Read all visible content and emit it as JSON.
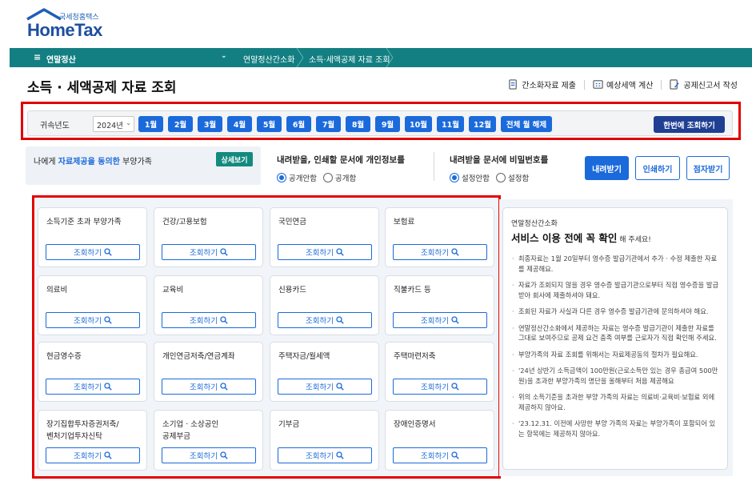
{
  "logo": {
    "subtitle": "국세청홈택스",
    "brand": "HomeTax"
  },
  "nav": {
    "menu_label": "연말정산",
    "crumb1": "연말정산간소화",
    "crumb2": "소득·세액공제 자료 조회"
  },
  "page_title": "소득 · 세액공제 자료 조회",
  "top_links": [
    {
      "label": "간소화자료 제출",
      "icon": "document-submit-icon"
    },
    {
      "label": "예상세액 계산",
      "icon": "calculator-icon"
    },
    {
      "label": "공제신고서 작성",
      "icon": "form-edit-icon"
    }
  ],
  "filter": {
    "year_label": "귀속년도",
    "year_value": "2024년",
    "months": [
      "1월",
      "2월",
      "3월",
      "4월",
      "5월",
      "6월",
      "7월",
      "8월",
      "9월",
      "10월",
      "11월",
      "12월"
    ],
    "all_clear": "전체 월 해제",
    "query_all": "한번에 조회하기"
  },
  "consent": {
    "prefix": "나에게 ",
    "highlight": "자료제공을 동의한",
    "suffix": " 부양가족",
    "detail_button": "상세보기"
  },
  "print_privacy": {
    "title": "내려받을, 인쇄할 문서에 개인정보를",
    "options": [
      "공개안함",
      "공개함"
    ],
    "selected": 0
  },
  "doc_password": {
    "title": "내려받을 문서에 비밀번호를",
    "options": [
      "설정안함",
      "설정함"
    ],
    "selected": 0
  },
  "actions": {
    "download": "내려받기",
    "print": "인쇄하기",
    "braille": "점자받기"
  },
  "cards": [
    {
      "title": "소득기준 초과 부양가족",
      "button": "조회하기"
    },
    {
      "title": "건강/고용보험",
      "button": "조회하기"
    },
    {
      "title": "국민연금",
      "button": "조회하기"
    },
    {
      "title": "보험료",
      "button": "조회하기"
    },
    {
      "title": "의료비",
      "button": "조회하기"
    },
    {
      "title": "교육비",
      "button": "조회하기"
    },
    {
      "title": "신용카드",
      "button": "조회하기"
    },
    {
      "title": "직불카드 등",
      "button": "조회하기"
    },
    {
      "title": "현금영수증",
      "button": "조회하기"
    },
    {
      "title": "개인연금저축/연금계좌",
      "button": "조회하기"
    },
    {
      "title": "주택자금/월세액",
      "button": "조회하기"
    },
    {
      "title": "주택마련저축",
      "button": "조회하기"
    },
    {
      "title": "장기집합투자증권저축/\n벤처기업투자신탁",
      "button": "조회하기"
    },
    {
      "title": "소기업 · 소상공인\n공제부금",
      "button": "조회하기"
    },
    {
      "title": "기부금",
      "button": "조회하기"
    },
    {
      "title": "장애인증명서",
      "button": "조회하기"
    }
  ],
  "notice": {
    "tag": "연말정산간소화",
    "headline": "서비스 이용 전에 꼭 확인",
    "headline_suffix": " 해 주세요!",
    "items": [
      "최종자료는 1월 20일부터 영수증 발급기관에서 추가 · 수정 제출한 자료를 제공해요.",
      "자료가 조회되지 않을 경우 영수증 발급기관으로부터 직접 영수증을 발급받아 회사에 제출하셔야 돼요.",
      "조회된 자료가 사실과 다른 경우 영수증 발급기관에 문의하셔야 해요.",
      "연말정산간소화에서 제공하는 자료는 영수증 발급기관이 제출한 자료를 그대로 보여주므로 공제 요건 충족 여부를 근로자가 직접 확인해 주세요.",
      "부양가족의 자료 조회를 위해서는 자료제공동의 절차가 필요해요.",
      "'24년 상반기 소득금액이 100만원(근로소득만 있는 경우 총급여 500만원)을 초과한 부양가족의 명단을 올해부터 처음 제공해요",
      "위의 소득기준을 초과한 부양 가족의 자료는 의료비·교육비·보험료 외에 제공하지 않아요.",
      "'23.12.31. 이전에 사망한 부양 가족의 자료는 부양가족이 포함되어 있는 항목에는 제공하지 않아요."
    ]
  },
  "colors": {
    "nav_bg": "#137f82",
    "primary": "#1b6adb",
    "dark_button": "#1f3f93",
    "highlight_box": "#e10000"
  }
}
